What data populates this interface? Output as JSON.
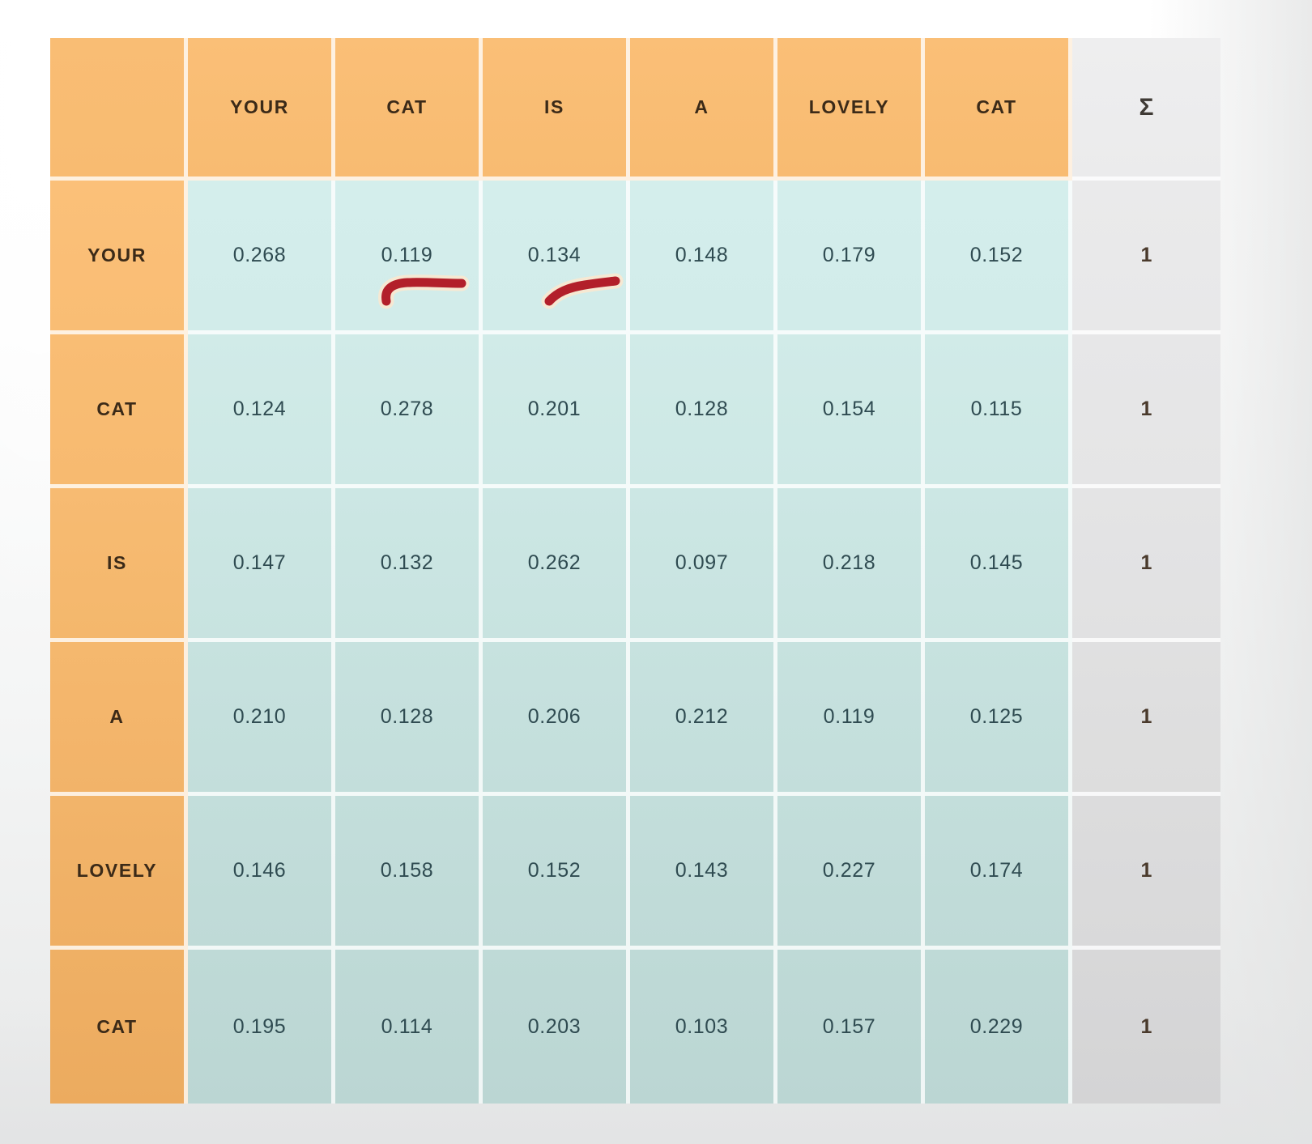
{
  "matrix": {
    "corner_label": "",
    "sum_header": "Σ",
    "column_headers": [
      "YOUR",
      "CAT",
      "IS",
      "A",
      "LOVELY",
      "CAT"
    ],
    "row_headers": [
      "YOUR",
      "CAT",
      "IS",
      "A",
      "LOVELY",
      "CAT"
    ],
    "row_sums": [
      "1",
      "1",
      "1",
      "1",
      "1",
      "1"
    ],
    "rows": [
      [
        "0.268",
        "0.119",
        "0.134",
        "0.148",
        "0.179",
        "0.152"
      ],
      [
        "0.124",
        "0.278",
        "0.201",
        "0.128",
        "0.154",
        "0.115"
      ],
      [
        "0.147",
        "0.132",
        "0.262",
        "0.097",
        "0.218",
        "0.145"
      ],
      [
        "0.210",
        "0.128",
        "0.206",
        "0.212",
        "0.119",
        "0.125"
      ],
      [
        "0.146",
        "0.158",
        "0.152",
        "0.143",
        "0.227",
        "0.174"
      ],
      [
        "0.195",
        "0.114",
        "0.203",
        "0.103",
        "0.157",
        "0.229"
      ]
    ]
  },
  "annotations": {
    "stroke_color": "#b21f2a",
    "strokes": [
      {
        "name": "red-underline-stroke-cat",
        "cell_row": "YOUR",
        "cell_col": "CAT",
        "value_marked": "0.119"
      },
      {
        "name": "red-underline-stroke-is",
        "cell_row": "YOUR",
        "cell_col": "IS",
        "value_marked": "0.134"
      }
    ]
  },
  "chart_data": {
    "type": "heatmap",
    "title": "",
    "xlabel": "",
    "ylabel": "",
    "categories": [
      "YOUR",
      "CAT",
      "IS",
      "A",
      "LOVELY",
      "CAT"
    ],
    "row_categories": [
      "YOUR",
      "CAT",
      "IS",
      "A",
      "LOVELY",
      "CAT"
    ],
    "series": [
      {
        "name": "YOUR",
        "values": [
          0.268,
          0.119,
          0.134,
          0.148,
          0.179,
          0.152
        ],
        "sum": 1
      },
      {
        "name": "CAT",
        "values": [
          0.124,
          0.278,
          0.201,
          0.128,
          0.154,
          0.115
        ],
        "sum": 1
      },
      {
        "name": "IS",
        "values": [
          0.147,
          0.132,
          0.262,
          0.097,
          0.218,
          0.145
        ],
        "sum": 1
      },
      {
        "name": "A",
        "values": [
          0.21,
          0.128,
          0.206,
          0.212,
          0.119,
          0.125
        ],
        "sum": 1
      },
      {
        "name": "LOVELY",
        "values": [
          0.146,
          0.158,
          0.152,
          0.143,
          0.227,
          0.174
        ],
        "sum": 1
      },
      {
        "name": "CAT",
        "values": [
          0.195,
          0.114,
          0.203,
          0.103,
          0.157,
          0.229
        ],
        "sum": 1
      }
    ],
    "sum_label": "Σ",
    "sum_values": [
      1,
      1,
      1,
      1,
      1,
      1
    ],
    "grid": true,
    "legend": "none",
    "colors": {
      "header": "#f9bd74",
      "cell": "#cde8e5",
      "sum_column": "#e4e4e5",
      "annotation": "#b21f2a"
    }
  }
}
